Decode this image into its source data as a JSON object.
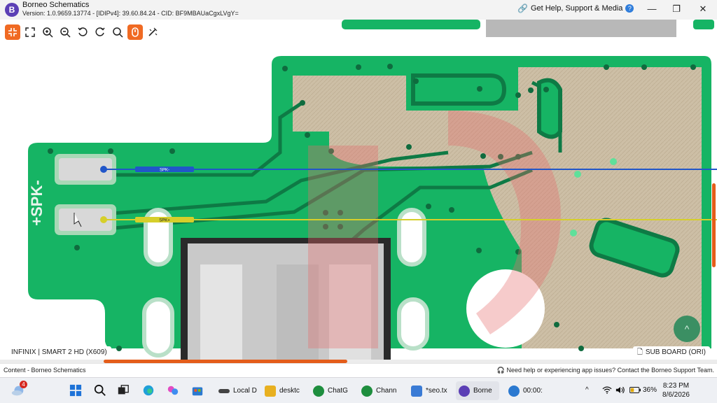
{
  "window": {
    "app_name": "Borneo Schematics",
    "version_line": "Version: 1.0.9659.13774 - [IDIPv4]: 39.60.84.24 - CID: BF9MBAUaCgxLVgY=",
    "help_link": "Get Help, Support & Media",
    "logo_letter": "B"
  },
  "toolbar": {
    "accent": "#f06a23",
    "tools": [
      "focus-icon",
      "fullscreen-icon",
      "zoom-in-icon",
      "zoom-out-icon",
      "rotate-left-icon",
      "rotate-right-icon",
      "search-icon",
      "hand-touch-icon",
      "magic-wand-icon"
    ]
  },
  "board": {
    "pcb_color": "#16b464",
    "nets": [
      {
        "label": "SPK-",
        "color": "#2156c9"
      },
      {
        "label": "SPK+",
        "color": "#d6cf2a"
      }
    ],
    "silkscreen": "+SPK-",
    "board_name": "INFINIX | SMART 2 HD (X609)",
    "sub_board": "SUB BOARD (ORI)",
    "scroll_up": "^"
  },
  "status": {
    "left": "Content - Borneo Schematics",
    "right": "Need help or experiencing app issues? Contact the Borneo Support Team."
  },
  "taskbar": {
    "weather_badge": "4",
    "apps": [
      {
        "label": "Local D",
        "color": "#444444"
      },
      {
        "label": "desktc",
        "color": "#e8b020"
      },
      {
        "label": "ChatG",
        "color": "#1e8e3e"
      },
      {
        "label": "Chann",
        "color": "#1e8e3e"
      },
      {
        "label": "*seo.tx",
        "color": "#3a7bd5"
      },
      {
        "label": "Borne",
        "color": "#5b3fb5"
      },
      {
        "label": "00:00:",
        "color": "#2b79d0"
      }
    ],
    "battery": "36%",
    "time": "8:23 PM",
    "date": "8/6/2026"
  }
}
